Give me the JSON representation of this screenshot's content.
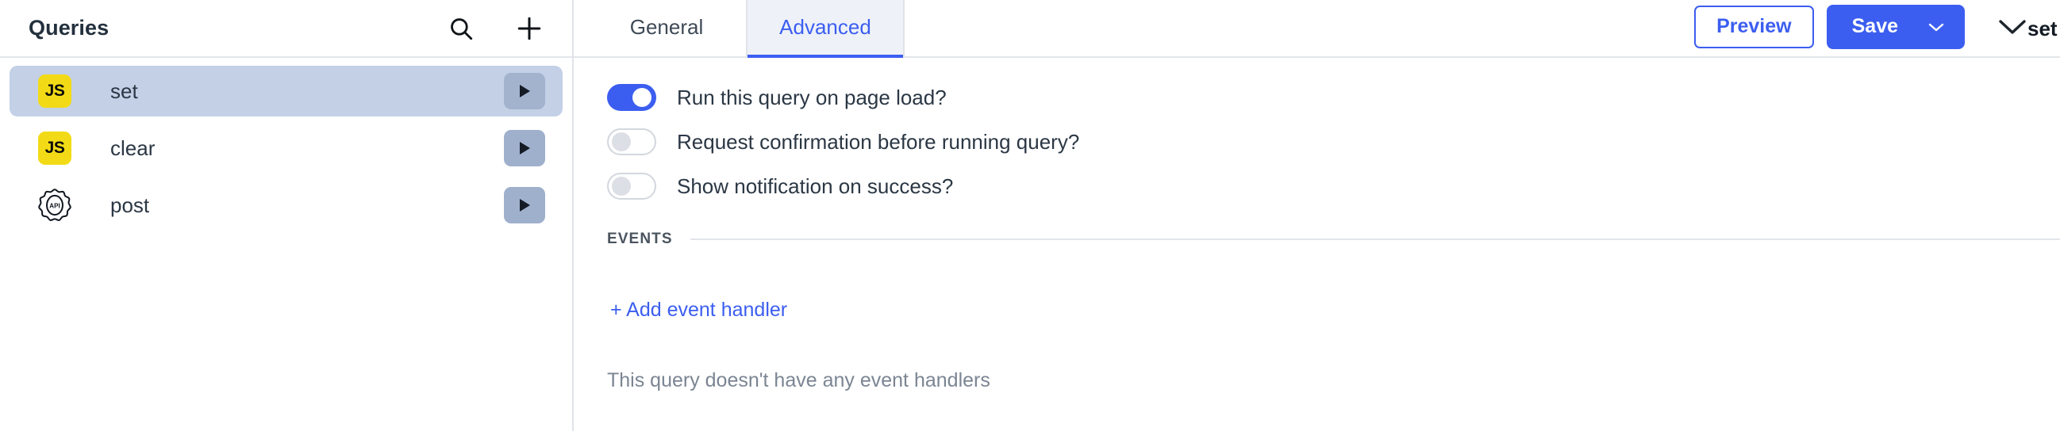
{
  "sidebar": {
    "title": "Queries",
    "actions": [
      {
        "name": "search-icon",
        "label": "Search"
      },
      {
        "name": "add-icon",
        "label": "Add"
      }
    ],
    "items": [
      {
        "label": "set",
        "icon": "js-icon",
        "icon_text": "JS",
        "selected": true,
        "run_label": "Run"
      },
      {
        "label": "clear",
        "icon": "js-icon",
        "icon_text": "JS",
        "selected": false,
        "run_label": "Run"
      },
      {
        "label": "post",
        "icon": "api-icon",
        "icon_text": "API",
        "selected": false,
        "run_label": "Run"
      }
    ]
  },
  "header": {
    "tabs": [
      {
        "label": "General",
        "active": false
      },
      {
        "label": "Advanced",
        "active": true
      }
    ],
    "query_name": "set",
    "preview_label": "Preview",
    "save_label": "Save",
    "save_caret": "⌄",
    "collapse_label": "Collapse"
  },
  "main": {
    "toggles": [
      {
        "label": "Run this query on page load?",
        "on": true
      },
      {
        "label": "Request confirmation before running query?",
        "on": false
      },
      {
        "label": "Show notification on success?",
        "on": false
      }
    ],
    "events": {
      "title": "EVENTS",
      "add_handler_label": "+ Add event handler",
      "empty_message": "This query doesn't have any event handlers"
    }
  },
  "colors": {
    "accent": "#3c5ef0",
    "selected_row": "#c3d0e6",
    "js_yellow": "#f2db16",
    "run_button": "#9fb0cc",
    "text_primary": "#2b3744",
    "text_muted": "#7b8593"
  }
}
